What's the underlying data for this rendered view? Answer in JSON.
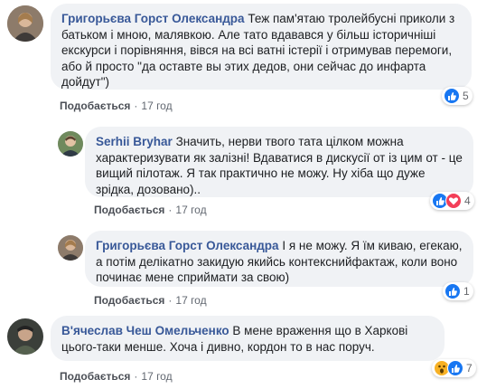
{
  "comments": [
    {
      "author": "Григорьєва Горст Олександра",
      "text": "Теж пам'ятаю тролейбусні приколи з батьком і мною, малявкою. Але тато вдавався у більш історичніші екскурси і порівняння, вівся на всі ватні істерії і отримував перемоги, або й просто \"да оставте вы этих дедов, они сейчас до инфарта дойдут\")",
      "like_label": "Подобається",
      "time": "17 год",
      "reactions": [
        "like"
      ],
      "reaction_count": "5"
    },
    {
      "author": "Serhii Bryhar",
      "text": "Значить, нерви твого тата цілком можна характеризувати як залізні! Вдаватися в дискусії от із цим от - це вищий пілотаж. Я так практично не можу. Ну хіба що дуже зрідка, дозовано)..",
      "like_label": "Подобається",
      "time": "17 год",
      "reactions": [
        "like",
        "love"
      ],
      "reaction_count": "4"
    },
    {
      "author": "Григорьєва Горст Олександра",
      "text": "І я не можу. Я їм киваю, егекаю, а потім делікатно закидую якийсь контекснийфактаж, коли воно починає мене сприймати за свою)",
      "like_label": "Подобається",
      "time": "17 год",
      "reactions": [
        "like"
      ],
      "reaction_count": "1"
    },
    {
      "author": "В'ячеслав Чеш Омельченко",
      "text": "В мене враження що в Харкові цього-таки менше. Хоча і дивно, кордон то в нас поруч.",
      "like_label": "Подобається",
      "time": "17 год",
      "reactions": [
        "wow",
        "like"
      ],
      "reaction_count": "7"
    }
  ],
  "colors": {
    "author": "#385898",
    "bubble": "#f0f2f5",
    "like": "#1877f2",
    "love": "#f33e58",
    "wow": "#f7b125"
  }
}
